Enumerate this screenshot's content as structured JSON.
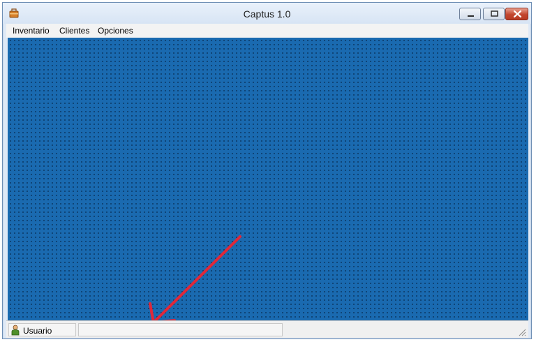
{
  "window": {
    "title": "Captus 1.0",
    "icon": "app-toolbox-icon",
    "controls": [
      "minimize-icon",
      "restore-icon",
      "close-icon"
    ]
  },
  "menubar": {
    "items": [
      {
        "label": "Inventario"
      },
      {
        "label": "Clientes"
      },
      {
        "label": "Opciones"
      }
    ]
  },
  "mdi_client": {
    "background_color": "#1a6ab0",
    "dot_color": "#0c3a68"
  },
  "annotation": {
    "icon": "red-arrow-icon",
    "color": "#e0283a"
  },
  "statusbar": {
    "user_icon": "user-icon",
    "user_label": "Usuario",
    "message": ""
  }
}
